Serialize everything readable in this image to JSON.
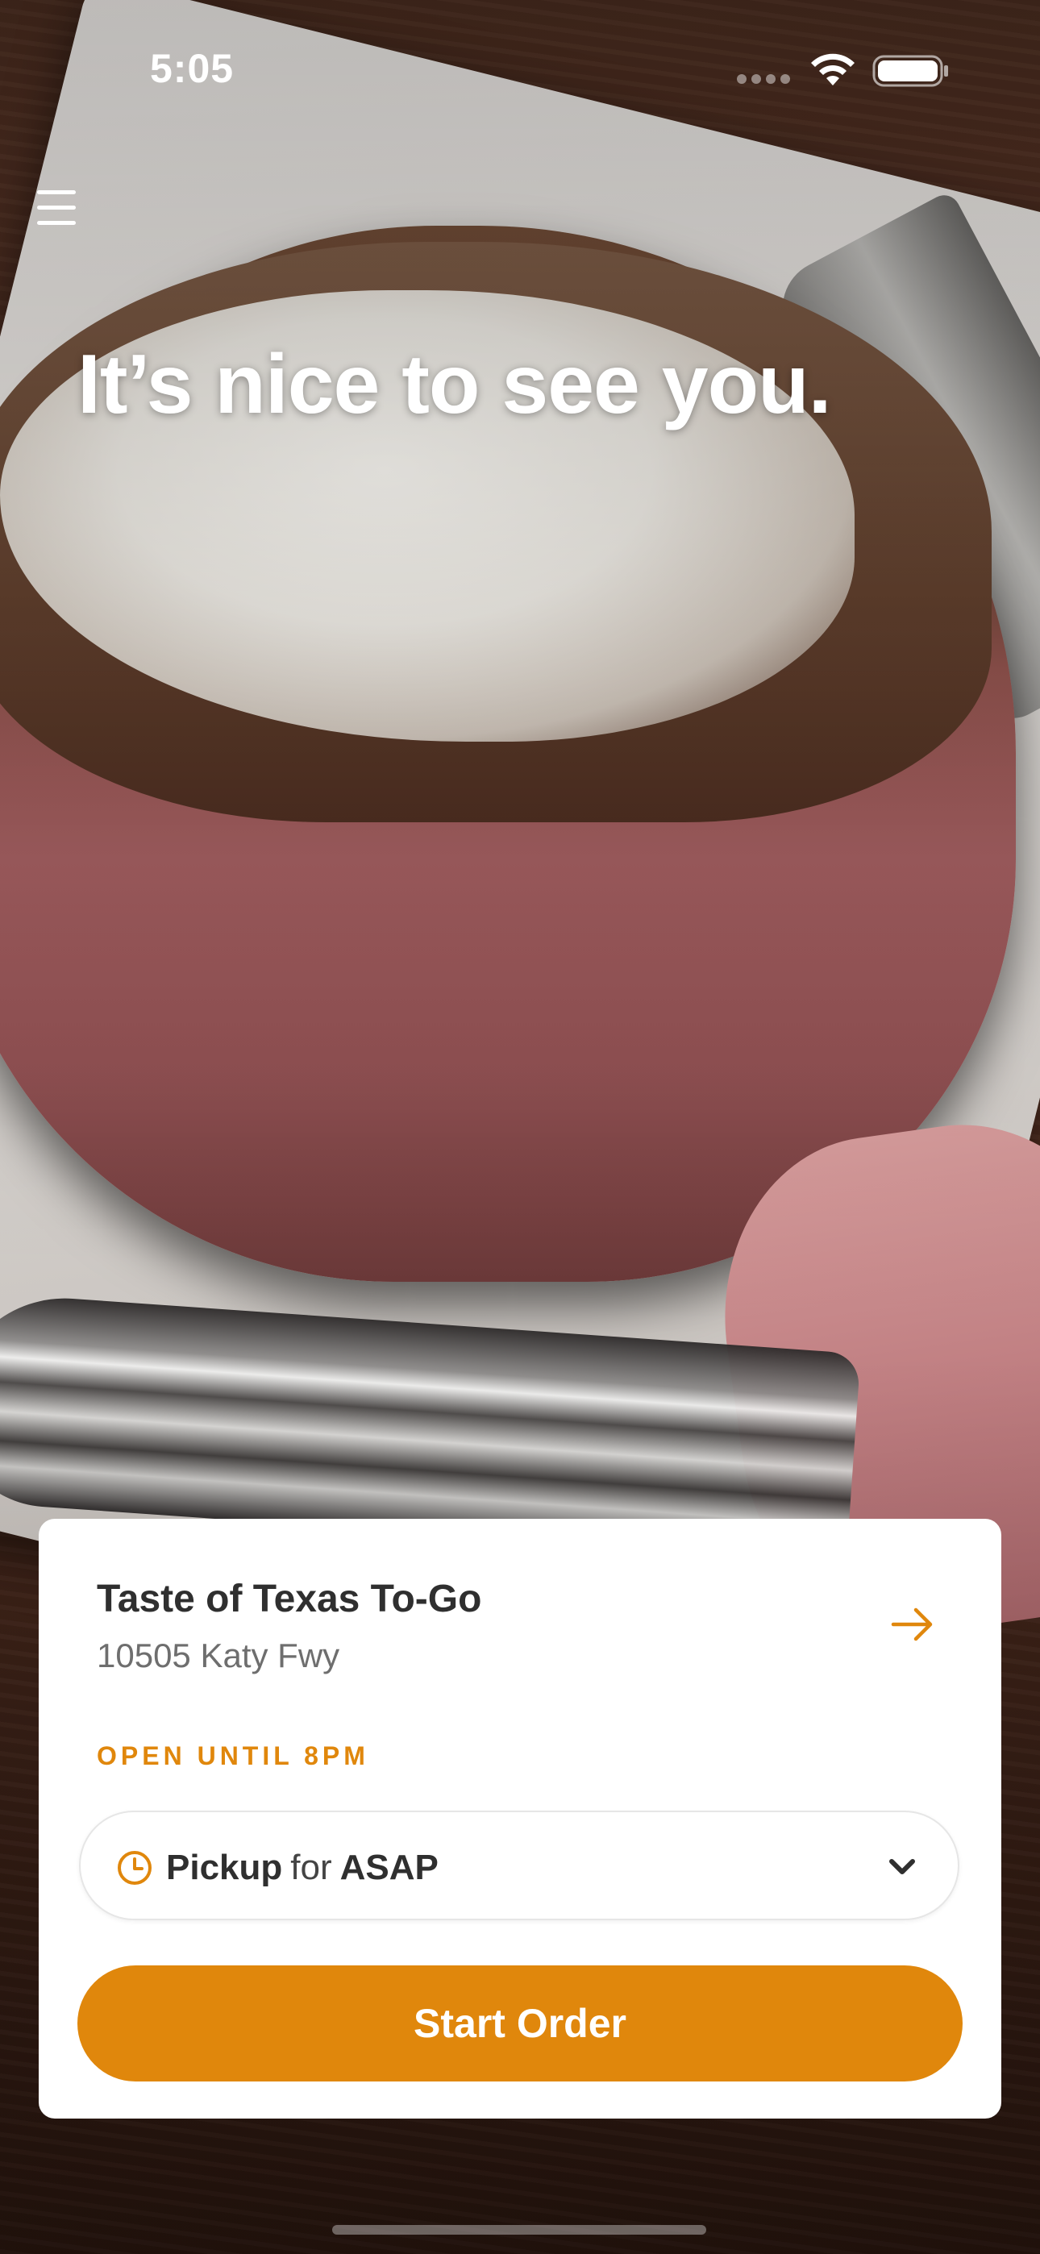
{
  "status_bar": {
    "time": "5:05"
  },
  "hero": {
    "greeting": "It’s nice to see you.",
    "background_image": "steak-with-butter-on-plate"
  },
  "store_card": {
    "name": "Taste of Texas To-Go",
    "address": "10505 Katy Fwy",
    "hours": "OPEN UNTIL 8PM",
    "order_type": "Pickup",
    "for_label": "for",
    "time_option": "ASAP",
    "start_label": "Start Order"
  },
  "icons": {
    "menu": "hamburger-menu-icon",
    "arrow": "arrow-right-icon",
    "clock": "clock-icon",
    "chevron": "chevron-down-icon"
  },
  "colors": {
    "accent": "#e0870c",
    "text_dark": "#2f2f2f",
    "text_muted": "#6e6e6e",
    "card_background": "#ffffff"
  }
}
